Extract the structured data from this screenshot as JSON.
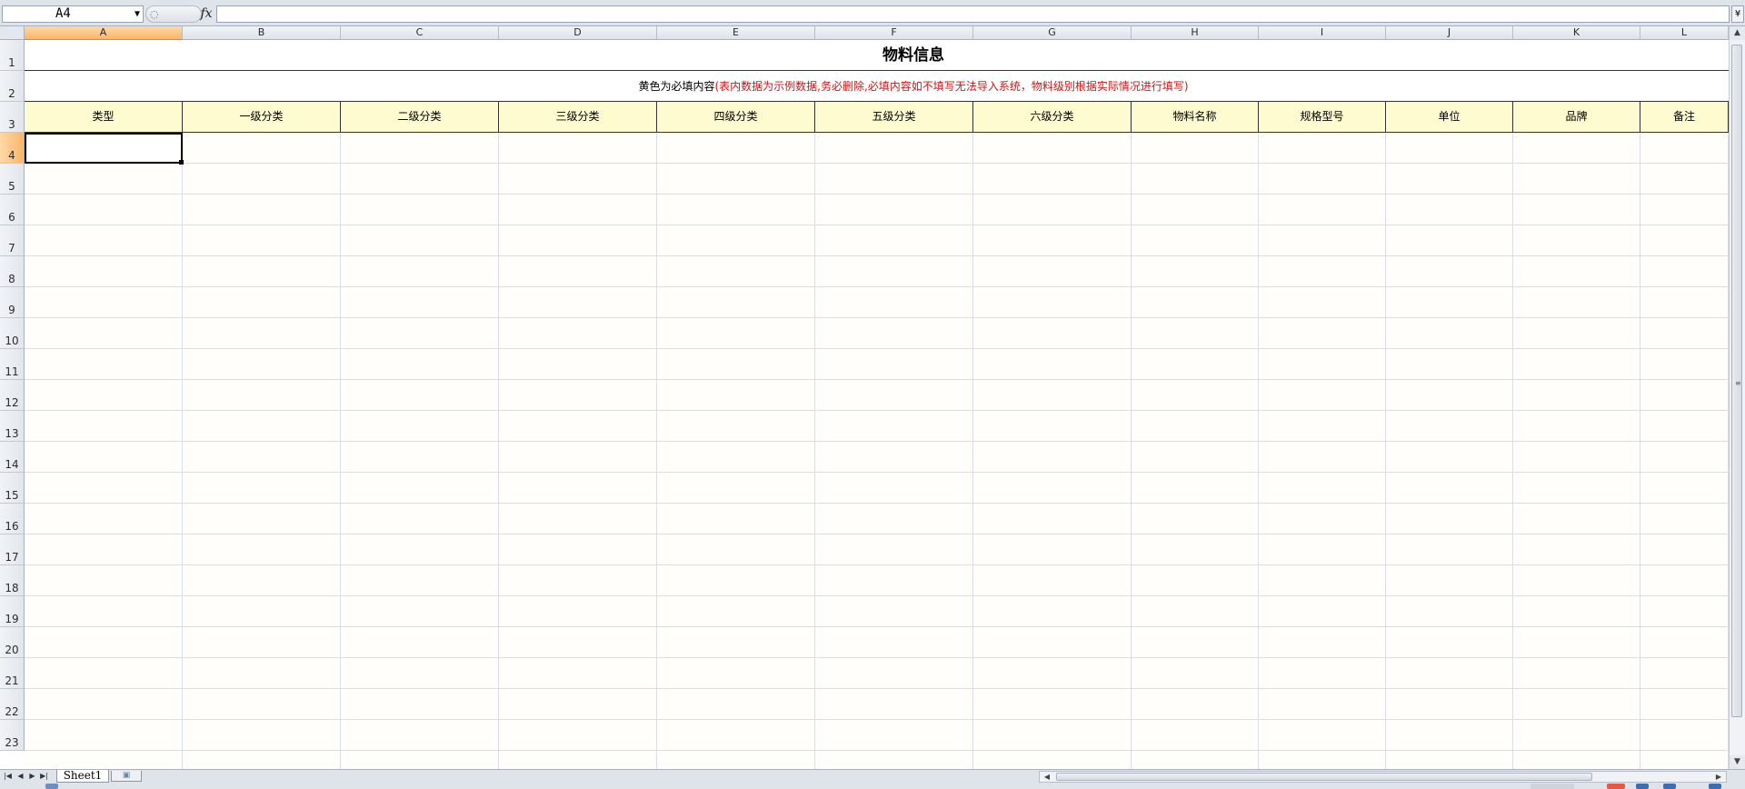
{
  "formula_bar": {
    "name_box": "A4",
    "fx_label": "fx",
    "formula": ""
  },
  "columns": [
    {
      "letter": "A"
    },
    {
      "letter": "B"
    },
    {
      "letter": "C"
    },
    {
      "letter": "D"
    },
    {
      "letter": "E"
    },
    {
      "letter": "F"
    },
    {
      "letter": "G"
    },
    {
      "letter": "H"
    },
    {
      "letter": "I"
    },
    {
      "letter": "J"
    },
    {
      "letter": "K"
    },
    {
      "letter": "L"
    }
  ],
  "rows": [
    "1",
    "2",
    "3",
    "4",
    "5",
    "6",
    "7",
    "8",
    "9",
    "10",
    "11",
    "12",
    "13",
    "14",
    "15",
    "16",
    "17",
    "18",
    "19",
    "20",
    "21",
    "22",
    "23"
  ],
  "sheet": {
    "title": "物料信息",
    "note_black": "黄色为必填内容",
    "note_red": "(表内数据为示例数据,务必删除,必填内容如不填写无法导入系统，物料级别根据实际情况进行填写)",
    "headers": [
      "类型",
      "一级分类",
      "二级分类",
      "三级分类",
      "四级分类",
      "五级分类",
      "六级分类",
      "物料名称",
      "规格型号",
      "单位",
      "品牌",
      "备注"
    ]
  },
  "tabs": {
    "sheets": [
      "Sheet1"
    ]
  },
  "colors": {
    "header_fill": "#fffbd0",
    "note_red": "#d21414",
    "active_header": "#f9b56a"
  }
}
